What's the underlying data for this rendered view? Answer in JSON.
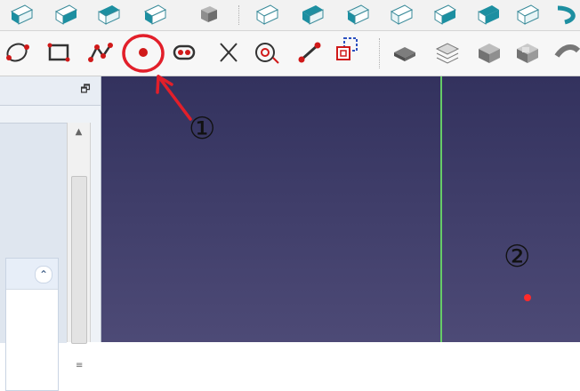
{
  "colors": {
    "viewport_top": "#33325e",
    "viewport_bottom": "#4d4a76",
    "axis_line": "#66cc66",
    "point": "#ff2a2a",
    "annotation_red": "#e21f2a",
    "toolbar_bg": "#f7f7f7"
  },
  "toolbar_top": {
    "items": [
      {
        "icon": "view-front-icon"
      },
      {
        "icon": "view-top-icon"
      },
      {
        "icon": "view-right-icon"
      },
      {
        "icon": "view-rear-icon"
      },
      {
        "icon": "view-gray-icon"
      },
      {
        "icon": "view-axonometric-icon"
      },
      {
        "icon": "view-bottom-icon"
      },
      {
        "icon": "view-left-icon"
      },
      {
        "icon": "view-sketch-icon"
      },
      {
        "icon": "view-section-icon"
      },
      {
        "icon": "view-rotate-icon"
      },
      {
        "icon": "view-fit-icon"
      },
      {
        "icon": "view-rotate-icon"
      }
    ]
  },
  "toolbar_sketcher": {
    "items": [
      {
        "icon": "conic-icon"
      },
      {
        "icon": "rectangle-icon"
      },
      {
        "icon": "polyline-icon"
      },
      {
        "icon": "point-icon",
        "highlighted": true
      },
      {
        "icon": "slot-icon"
      },
      {
        "icon": "trim-icon"
      },
      {
        "icon": "external-geometry-icon"
      },
      {
        "icon": "line-icon"
      },
      {
        "icon": "carbon-copy-icon"
      },
      {
        "icon": "block-solid-icon"
      },
      {
        "icon": "stack-icon"
      },
      {
        "icon": "solid-box-icon"
      },
      {
        "icon": "solid-cut-icon"
      },
      {
        "icon": "fillet-icon"
      }
    ]
  },
  "panel": {
    "float_button": "🗗",
    "collapse_button": "⌃",
    "scroll_up": "▲",
    "scroll_grip": "≡"
  },
  "annotations": {
    "label_1": "①",
    "label_2": "②"
  }
}
